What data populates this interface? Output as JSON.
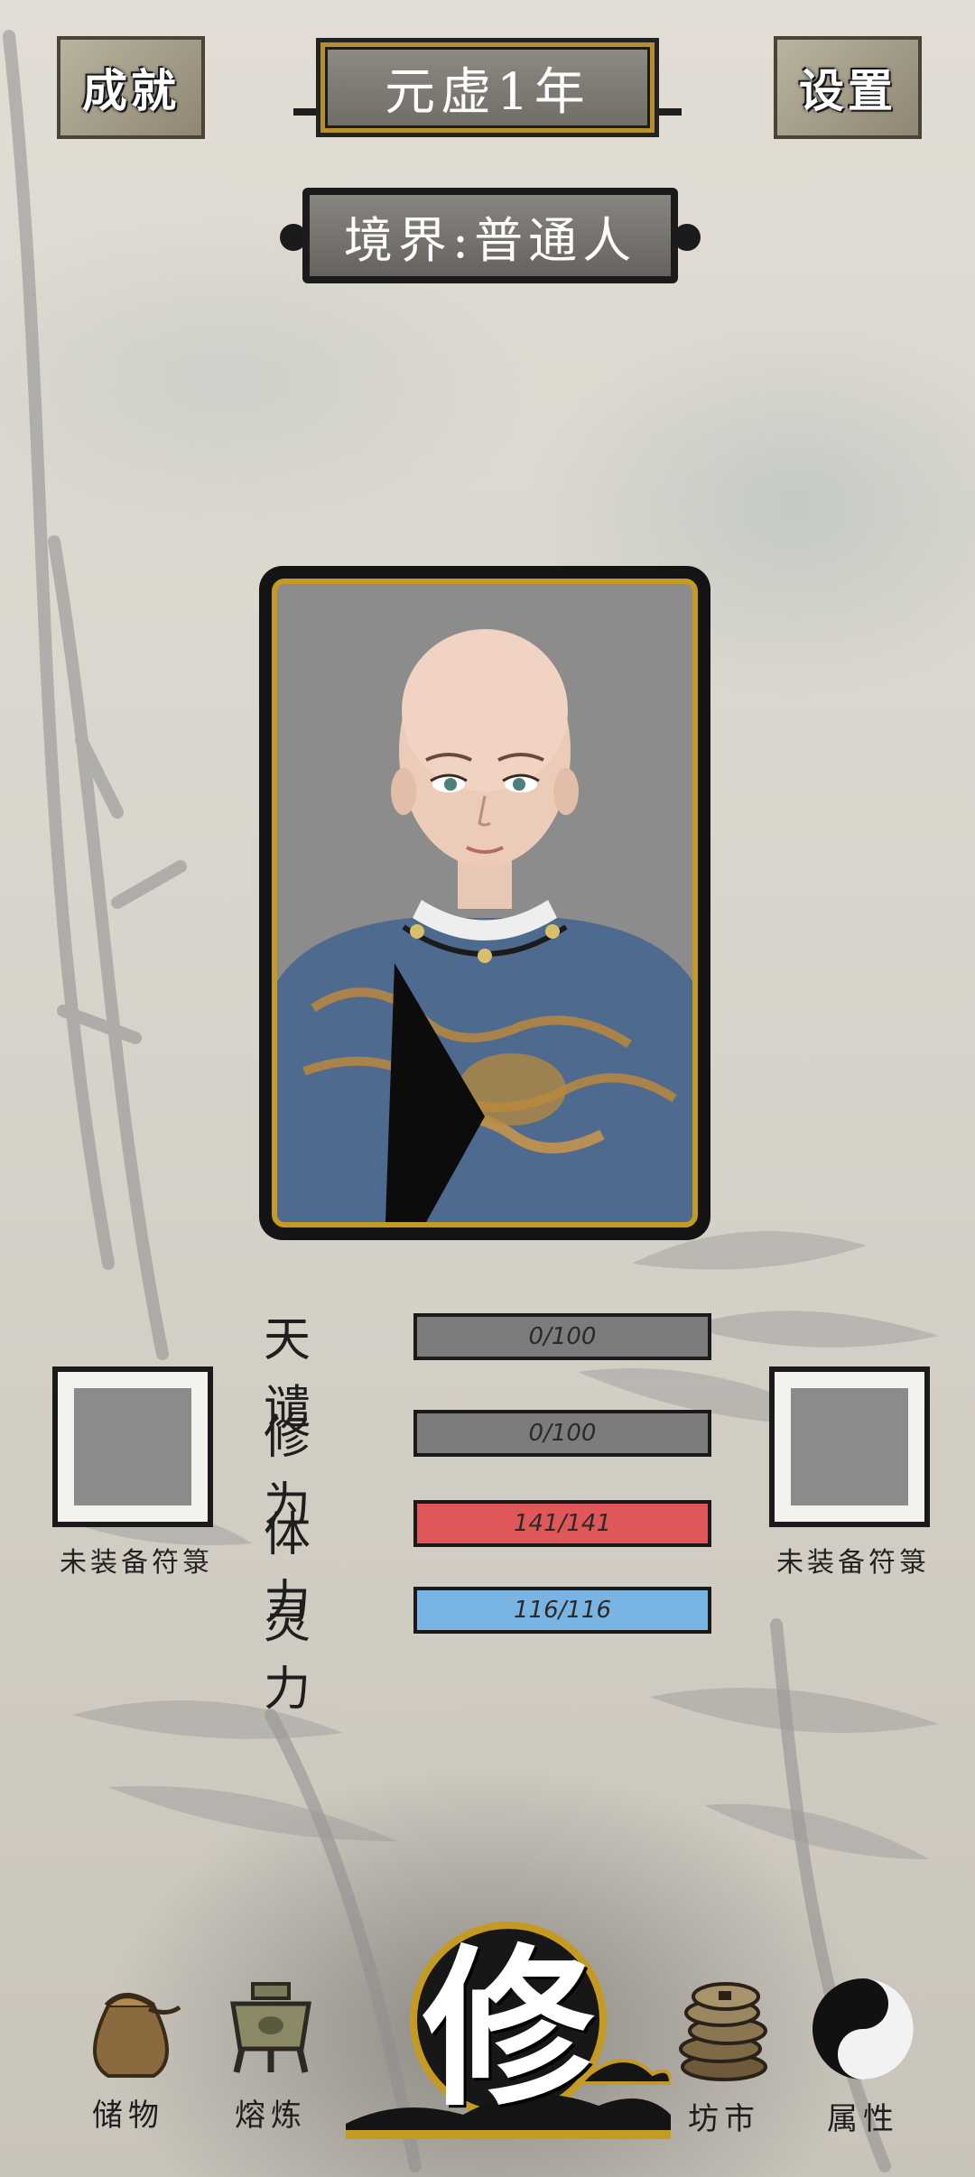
{
  "top": {
    "achievements_label": "成就",
    "settings_label": "设置",
    "year": "元虚1年",
    "realm": "境界:普通人"
  },
  "stats": [
    {
      "label": "天谴",
      "value": "0/100",
      "current": 0,
      "max": 100,
      "color": "#7c7c7c"
    },
    {
      "label": "修为",
      "value": "0/100",
      "current": 0,
      "max": 100,
      "color": "#7c7c7c"
    },
    {
      "label": "体力",
      "value": "141/141",
      "current": 141,
      "max": 141,
      "color": "#e0575a"
    },
    {
      "label": "灵力",
      "value": "116/116",
      "current": 116,
      "max": 116,
      "color": "#79b4e3"
    }
  ],
  "talisman_slots": [
    {
      "label": "未装备符箓"
    },
    {
      "label": "未装备符箓"
    }
  ],
  "nav": {
    "storage": "储物",
    "smelt": "熔炼",
    "cultivate": "修",
    "market": "坊市",
    "attributes": "属性"
  },
  "colors": {
    "frame_gold": "#c59a22",
    "stamina": "#e0575a",
    "spirit": "#79b4e3"
  }
}
